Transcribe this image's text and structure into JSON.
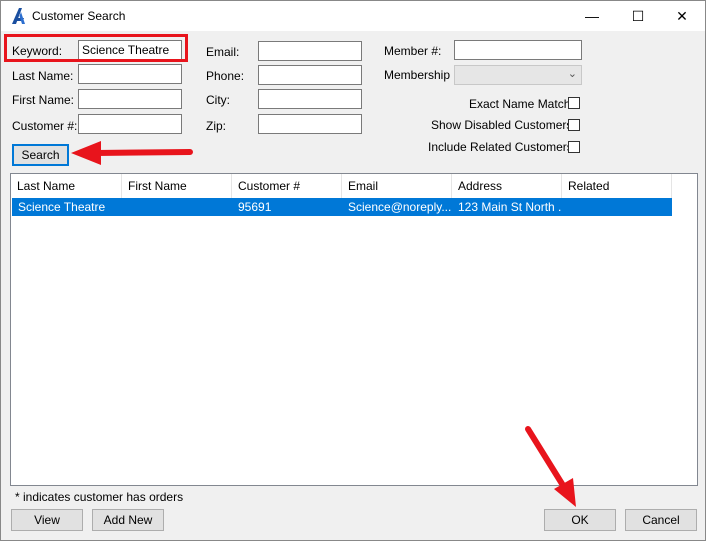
{
  "window": {
    "title": "Customer Search",
    "minimize": "—",
    "maximize": "☐",
    "close": "✕"
  },
  "form": {
    "keyword_label": "Keyword:",
    "keyword_value": "Science Theatre",
    "lastname_label": "Last Name:",
    "firstname_label": "First Name:",
    "customer_no_label": "Customer #:",
    "email_label": "Email:",
    "phone_label": "Phone:",
    "city_label": "City:",
    "zip_label": "Zip:",
    "member_no_label": "Member #:",
    "membership_label": "Membership",
    "exact_name_label": "Exact Name Match",
    "show_disabled_label": "Show Disabled Customers",
    "include_related_label": "Include Related Customers",
    "search_button": "Search"
  },
  "grid": {
    "columns": [
      "Last Name",
      "First Name",
      "Customer #",
      "Email",
      "Address",
      "Related"
    ],
    "rows": [
      {
        "last_name": "Science Theatre",
        "first_name": "",
        "customer_no": "95691",
        "email": "Science@noreply....",
        "address": "123 Main St North ...",
        "related": ""
      }
    ]
  },
  "footer": {
    "note": "* indicates customer has orders",
    "view_button": "View",
    "add_new_button": "Add New",
    "ok_button": "OK",
    "cancel_button": "Cancel"
  },
  "annotation_color": "#e8141c",
  "selection_color": "#0078d7"
}
